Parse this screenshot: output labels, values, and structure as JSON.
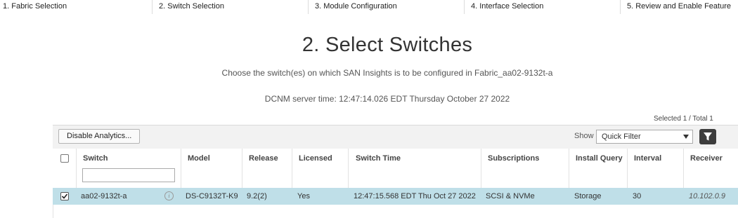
{
  "steps": [
    {
      "label": "1. Fabric Selection"
    },
    {
      "label": "2. Switch Selection"
    },
    {
      "label": "3. Module Configuration"
    },
    {
      "label": "4. Interface Selection"
    },
    {
      "label": "5. Review and Enable Feature"
    }
  ],
  "title": "2. Select Switches",
  "subtitle": "Choose the switch(es) on which SAN Insights is to be configured in Fabric_aa02-9132t-a",
  "server_time": "DCNM server time: 12:47:14.026 EDT Thursday October 27 2022",
  "selected_count": "Selected 1 / Total 1",
  "toolbar": {
    "disable_button": "Disable Analytics...",
    "show_label": "Show",
    "filter_select_value": "Quick Filter",
    "filter_icon": "funnel-icon"
  },
  "table": {
    "columns": [
      "Switch",
      "Model",
      "Release",
      "Licensed",
      "Switch Time",
      "Subscriptions",
      "Install Query",
      "Interval",
      "Receiver"
    ],
    "switch_filter_placeholder": "",
    "rows": [
      {
        "selected": true,
        "switch": "aa02-9132t-a",
        "model": "DS-C9132T-K9",
        "release": "9.2(2)",
        "licensed": "Yes",
        "switch_time": "12:47:15.568 EDT Thu Oct 27 2022",
        "subscriptions": "SCSI & NVMe",
        "install_query": "Storage",
        "interval": "30",
        "receiver": "10.102.0.9"
      }
    ]
  }
}
